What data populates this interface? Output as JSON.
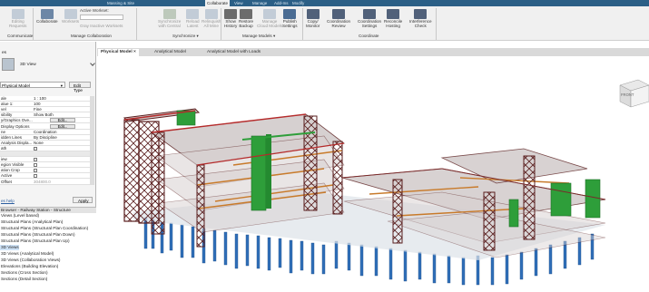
{
  "ribbon_tabs": [
    "Massing & Site",
    "Collaborate",
    "View",
    "Manage",
    "Add-Ins",
    "Modify"
  ],
  "ribbon_tab_active": "Collaborate",
  "active_workset": {
    "label": "Active Workset:"
  },
  "ribbon": {
    "editing_requests": "Editing\nRequests",
    "collaborate": "Collaborate",
    "worksets": "Worksets",
    "gray_inactive": "Gray Inactive Worksets",
    "synchronize_cloud": "Synchronize\nwith Central",
    "reload_latest": "Reload\nLatest",
    "relinquish_all": "Relinquish\nAll Mine",
    "show_history": "Show\nHistory",
    "restore_backup": "Restore\nBackup",
    "manage_cloud_models": "Manage\nCloud Models",
    "publish_settings": "Publish\nSettings",
    "copy_monitor": "Copy/\nMonitor",
    "coordination_review": "Coordination\nReview",
    "coordination_settings": "Coordination\nSettings",
    "reconcile_hosting": "Reconcile\nHosting",
    "interference_check": "Interference\nCheck",
    "group_communicate": "Communicate",
    "group_manage_collab": "Manage Collaboration",
    "group_synchronize": "Synchronize ▾",
    "group_manage_models": "Manage Models ▾",
    "group_coordinate": "Coordinate"
  },
  "properties": {
    "header": "es",
    "type_name": "3D View",
    "view_selector": "Physical Model",
    "edit_type": "Edit Type",
    "rows": [
      {
        "k": "ale",
        "v": "1 : 100"
      },
      {
        "k": "alue   1:",
        "v": "100"
      },
      {
        "k": "vel",
        "v": "Fine"
      },
      {
        "k": "sibility",
        "v": "Show Both"
      },
      {
        "k": "y/Graphics Ove...",
        "v": "",
        "btn": "Edit..."
      },
      {
        "k": "Display Options",
        "v": "",
        "btn": "Edit..."
      },
      {
        "k": "ne",
        "v": "Coordination"
      },
      {
        "k": "idden Lines",
        "v": "By Discipline"
      },
      {
        "k": "Analysis Displa...",
        "v": "None"
      },
      {
        "k": "ath",
        "v": "",
        "chk": true
      },
      {
        "k": "",
        "v": ""
      },
      {
        "k": "iew",
        "v": "",
        "chk": true
      },
      {
        "k": "egion Visible",
        "v": "",
        "chk": true
      },
      {
        "k": "ation Crop",
        "v": "",
        "chk": true
      },
      {
        "k": "Active",
        "v": "",
        "chk": true
      },
      {
        "k": "Offset",
        "v": "304800.0"
      }
    ],
    "help": "es help",
    "apply": "Apply"
  },
  "browser": {
    "title": "Browser - Railway Station - Structure",
    "items": [
      "Views (Level based)",
      "Structural Plans (Analytical Plan)",
      "Structural Plans (Structural Plan Coordination)",
      "Structural Plans (Structural Plan Down)",
      "Structural Plans (Structural Plan Up)",
      "3D Views",
      "3D Views (Analytical Model)",
      "3D Views (Collaboration Views)",
      "Elevations (Building Elevation)",
      "Sections (Cross Section)",
      "Sections (Detail Section)"
    ],
    "selected_index": 5
  },
  "view_tabs": [
    {
      "label": "Physical Model",
      "active": true
    },
    {
      "label": "Analytical Model",
      "active": false
    },
    {
      "label": "Analytical Model with Loads",
      "active": false
    }
  ],
  "viewcube_label": "FRONT",
  "colors": {
    "ribbon_tab_bar": "#2b5f86",
    "steel": "#5a1f1f",
    "core": "#2e9e3a",
    "piles": "#2f6fb8",
    "beams": "#c87a2a",
    "slabs": "#cfc8c8"
  }
}
